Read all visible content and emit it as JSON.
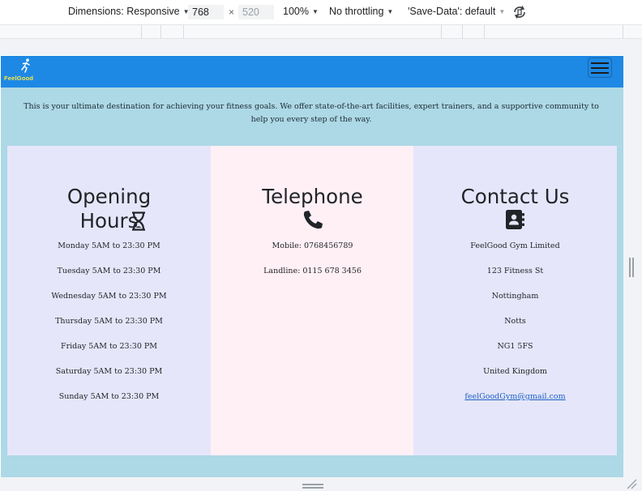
{
  "devtools": {
    "dimensions_label": "Dimensions: Responsive",
    "width_value": "768",
    "height_value": "520",
    "times": "×",
    "zoom": "100%",
    "throttling": "No throttling",
    "save_data": "'Save-Data': default"
  },
  "site": {
    "logo_text": "FeelGood",
    "colors": {
      "navbar": "#1e88e5",
      "page_bg": "#add8e6",
      "column_lavender": "#e6e6fa",
      "column_pink": "#fff0f5",
      "logo_text": "#ffeb3b"
    },
    "intro": "This is your ultimate destination for achieving your fitness goals. We offer state-of-the-art facilities, expert trainers, and a supportive community to help you every step of the way.",
    "opening_hours": {
      "title": "Opening Hours",
      "icon": "hourglass-icon",
      "items": [
        "Monday 5AM to 23:30 PM",
        "Tuesday 5AM to 23:30 PM",
        "Wednesday 5AM to 23:30 PM",
        "Thursday 5AM to 23:30 PM",
        "Friday 5AM to 23:30 PM",
        "Saturday 5AM to 23:30 PM",
        "Sunday 5AM to 23:30 PM"
      ]
    },
    "telephone": {
      "title": "Telephone",
      "icon": "phone-icon",
      "items": [
        "Mobile: 0768456789",
        "Landline: 0115 678 3456"
      ]
    },
    "contact": {
      "title": "Contact Us",
      "icon": "address-book-icon",
      "items": [
        "FeelGood Gym Limited",
        "123 Fitness St",
        "Nottingham",
        "Notts",
        "NG1 5FS",
        "United Kingdom"
      ],
      "email": "feelGoodGym@gmail.com"
    }
  }
}
